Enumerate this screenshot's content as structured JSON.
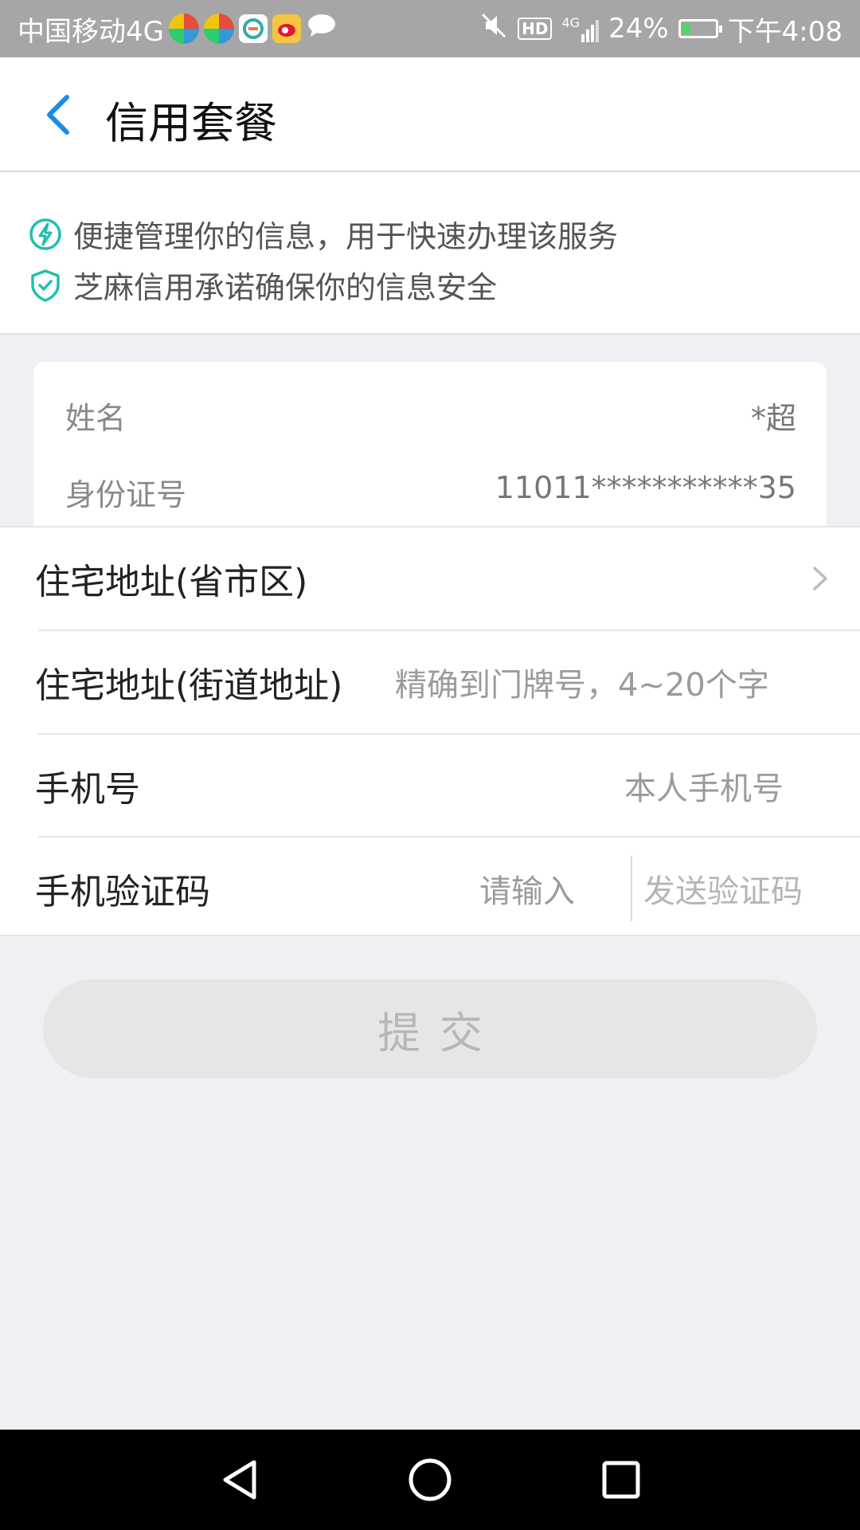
{
  "status_bar": {
    "carrier": "中国移动4G",
    "hd": "HD",
    "network": "4G",
    "battery": "24%",
    "battery_level": 0.24,
    "time": "下午4:08"
  },
  "header": {
    "title": "信用套餐"
  },
  "info": {
    "line1": "便捷管理你的信息，用于快速办理该服务",
    "line2": "芝麻信用承诺确保你的信息安全",
    "accent_color": "#1fbfae"
  },
  "identity": {
    "name_label": "姓名",
    "name_value": "*超",
    "id_label": "身份证号",
    "id_value": "11011***********35"
  },
  "form": {
    "address_region_label": "住宅地址(省市区)",
    "address_street_label": "住宅地址(街道地址)",
    "address_street_placeholder": "精确到门牌号，4~20个字",
    "phone_label": "手机号",
    "phone_placeholder": "本人手机号",
    "code_label": "手机验证码",
    "code_placeholder": "请输入",
    "send_code_label": "发送验证码"
  },
  "submit": {
    "label": "提交"
  },
  "colors": {
    "back_arrow": "#1a8ce6",
    "status_bar_bg": "#a6a6a6",
    "page_bg": "#efeff4"
  }
}
